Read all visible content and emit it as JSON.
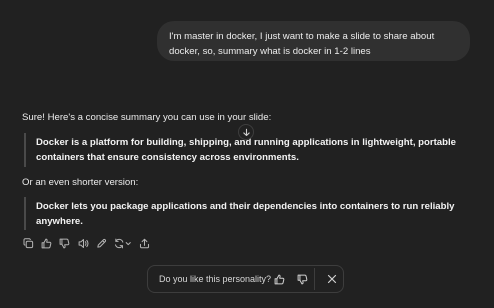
{
  "user_message": {
    "lines": [
      "I'm master in docker, I just want to make a slide to share about",
      "docker, so, summary what is docker in 1-2 lines"
    ]
  },
  "assistant": {
    "intro": "Sure! Here's a concise summary you can use in your slide:",
    "quote1": [
      "Docker is a platform for building, shipping, and running applications in lightweight, portable",
      "containers that ensure consistency across environments."
    ],
    "alt_intro": "Or an even shorter version:",
    "quote2": [
      "Docker lets you package applications and their dependencies into containers to run reliably",
      "anywhere."
    ]
  },
  "actions": [
    {
      "icon": "copy-icon"
    },
    {
      "icon": "thumbs-up-icon"
    },
    {
      "icon": "thumbs-down-icon"
    },
    {
      "icon": "read-aloud-icon"
    },
    {
      "icon": "edit-icon"
    },
    {
      "icon": "regenerate-icon"
    },
    {
      "icon": "share-icon"
    }
  ],
  "feedback": {
    "question": "Do you like this personality?"
  },
  "colors": {
    "background": "#212121",
    "user_bubble": "#303030",
    "text": "#ececec"
  }
}
